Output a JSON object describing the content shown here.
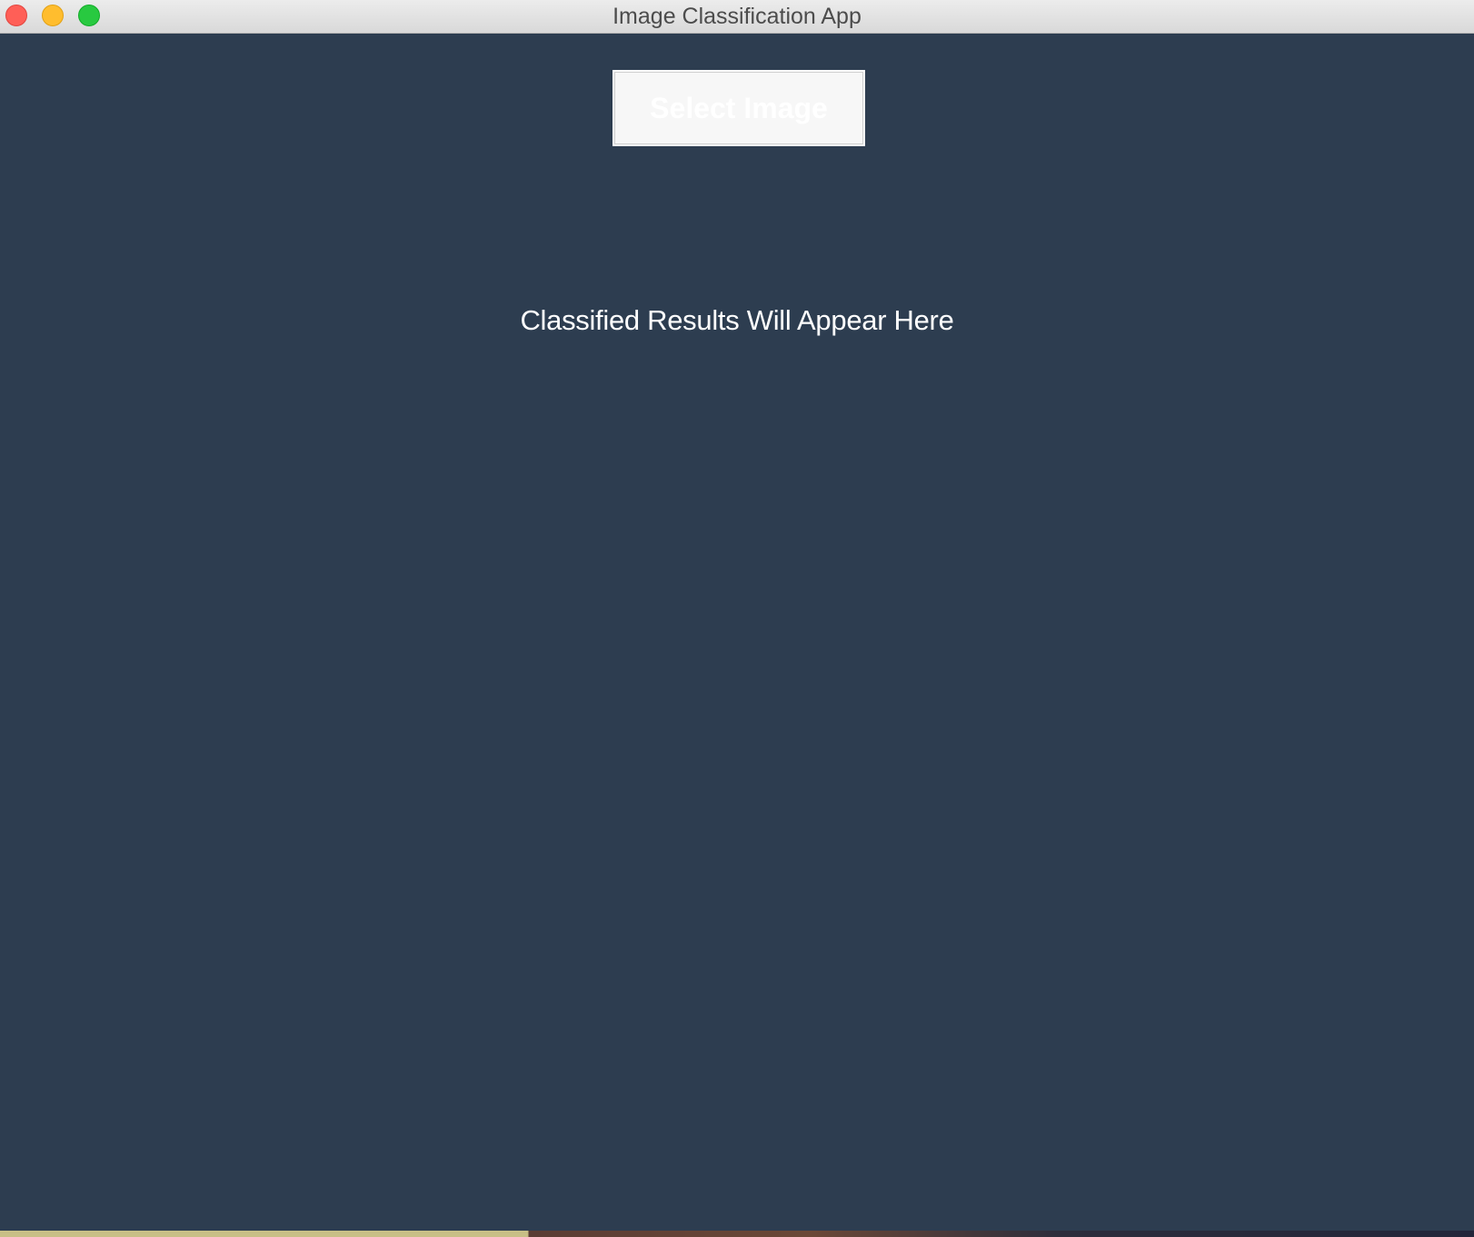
{
  "window": {
    "title": "Image Classification App"
  },
  "main": {
    "select_button_label": "Select Image",
    "results_placeholder": "Classified Results Will Appear Here"
  },
  "colors": {
    "background": "#2d3d50",
    "button_background": "#f7f7f7",
    "text": "#ffffff",
    "close": "#ff5f57",
    "minimize": "#ffbd2e",
    "zoom": "#28c940"
  }
}
